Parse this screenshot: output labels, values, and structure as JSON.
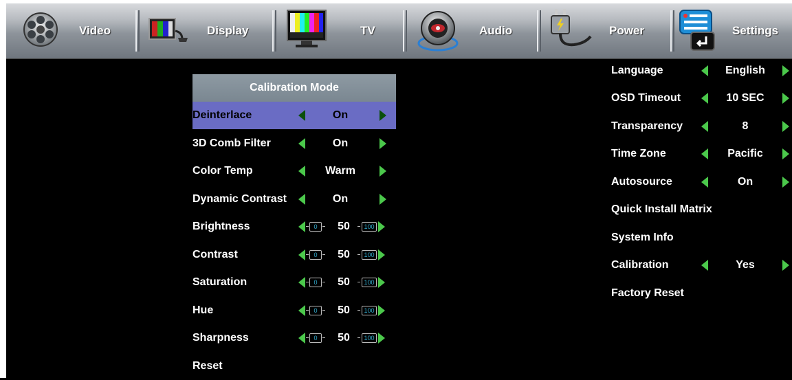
{
  "menu": {
    "tabs": [
      {
        "label": "Video",
        "icon": "film-reel-icon"
      },
      {
        "label": "Display",
        "icon": "monitor-display-icon"
      },
      {
        "label": "TV",
        "icon": "tv-color-bars-icon"
      },
      {
        "label": "Audio",
        "icon": "speaker-icon"
      },
      {
        "label": "Power",
        "icon": "power-plug-icon"
      },
      {
        "label": "Settings",
        "icon": "settings-list-icon"
      }
    ]
  },
  "calibration": {
    "title": "Calibration Mode",
    "rows": [
      {
        "name": "Deinterlace",
        "value": "On"
      },
      {
        "name": "3D Comb Filter",
        "value": "On"
      },
      {
        "name": "Color Temp",
        "value": "Warm"
      },
      {
        "name": "Dynamic Contrast",
        "value": "On"
      },
      {
        "name": "Brightness",
        "value": "50",
        "min": "0",
        "max": "100"
      },
      {
        "name": "Contrast",
        "value": "50",
        "min": "0",
        "max": "100"
      },
      {
        "name": "Saturation",
        "value": "50",
        "min": "0",
        "max": "100"
      },
      {
        "name": "Hue",
        "value": "50",
        "min": "0",
        "max": "100"
      },
      {
        "name": "Sharpness",
        "value": "50",
        "min": "0",
        "max": "100"
      },
      {
        "name": "Reset"
      }
    ]
  },
  "settings": {
    "rows": [
      {
        "name": "Language",
        "value": "English"
      },
      {
        "name": "OSD Timeout",
        "value": "10 SEC"
      },
      {
        "name": "Transparency",
        "value": "8"
      },
      {
        "name": "Time Zone",
        "value": "Pacific"
      },
      {
        "name": "Autosource",
        "value": "On"
      },
      {
        "name": "Quick Install Matrix"
      },
      {
        "name": "System Info"
      },
      {
        "name": "Calibration",
        "value": "Yes"
      },
      {
        "name": "Factory Reset"
      }
    ]
  },
  "colors": {
    "selection": "#6a6cc4",
    "arrow": "#4bc84b",
    "panel_title": "#8e9aa3"
  }
}
